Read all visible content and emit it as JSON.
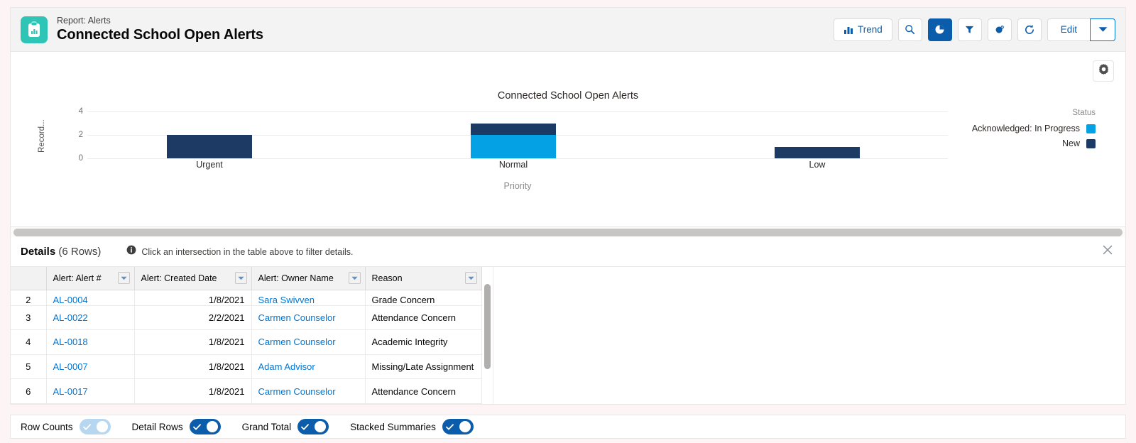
{
  "header": {
    "eyebrow": "Report: Alerts",
    "title": "Connected School Open Alerts",
    "icon": "report-clipboard-chart-icon",
    "toolbar": {
      "trend_label": "Trend",
      "trend_icon": "bar-chart-icon",
      "search_icon": "search-icon",
      "chart_icon": "pie-chart-icon",
      "filter_icon": "funnel-icon",
      "subscribe_icon": "bell-icon",
      "refresh_icon": "refresh-icon",
      "edit_label": "Edit",
      "edit_caret_icon": "chevron-down-icon"
    }
  },
  "chart_panel": {
    "gear_icon": "gear-icon",
    "hscroll": "horizontal-scrollbar"
  },
  "chart_data": {
    "type": "bar",
    "stacked": true,
    "title": "Connected School Open Alerts",
    "xlabel": "Priority",
    "ylabel": "Record...",
    "categories": [
      "Urgent",
      "Normal",
      "Low"
    ],
    "series": [
      {
        "name": "Acknowledged: In Progress",
        "color": "#04a1e5",
        "values": [
          0,
          2,
          0
        ]
      },
      {
        "name": "New",
        "color": "#1c3a63",
        "values": [
          2,
          1,
          1
        ]
      }
    ],
    "legend_title": "Status",
    "legend_position": "right",
    "ylim": [
      0,
      4
    ],
    "yticks": [
      0,
      2,
      4
    ],
    "grid": true
  },
  "details": {
    "label": "Details",
    "count": "(6 Rows)",
    "hint_icon": "info-icon",
    "hint": "Click an intersection in the table above to filter details.",
    "close_icon": "close-icon",
    "columns": [
      {
        "label": "Alert: Alert #",
        "caret": "column-menu-icon"
      },
      {
        "label": "Alert: Created Date",
        "caret": "column-menu-icon"
      },
      {
        "label": "Alert: Owner Name",
        "caret": "column-menu-icon"
      },
      {
        "label": "Reason",
        "caret": "column-menu-icon"
      }
    ],
    "rows": [
      {
        "n": "2",
        "alert": "AL-0004",
        "created": "1/8/2021",
        "owner": "Sara Swivven",
        "reason": "Grade Concern"
      },
      {
        "n": "3",
        "alert": "AL-0022",
        "created": "2/2/2021",
        "owner": "Carmen Counselor",
        "reason": "Attendance Concern"
      },
      {
        "n": "4",
        "alert": "AL-0018",
        "created": "1/8/2021",
        "owner": "Carmen Counselor",
        "reason": "Academic Integrity"
      },
      {
        "n": "5",
        "alert": "AL-0007",
        "created": "1/8/2021",
        "owner": "Adam Advisor",
        "reason": "Missing/Late Assignment"
      },
      {
        "n": "6",
        "alert": "AL-0017",
        "created": "1/8/2021",
        "owner": "Carmen Counselor",
        "reason": "Attendance Concern"
      }
    ]
  },
  "bottom_bar": {
    "toggles": [
      {
        "label": "Row Counts",
        "on": false
      },
      {
        "label": "Detail Rows",
        "on": true
      },
      {
        "label": "Grand Total",
        "on": true
      },
      {
        "label": "Stacked Summaries",
        "on": true
      }
    ]
  },
  "colors": {
    "accent": "#0b5cab",
    "link": "#0176d3",
    "brand_teal": "#2ec5b6",
    "series_in_progress": "#04a1e5",
    "series_new": "#1c3a63"
  }
}
